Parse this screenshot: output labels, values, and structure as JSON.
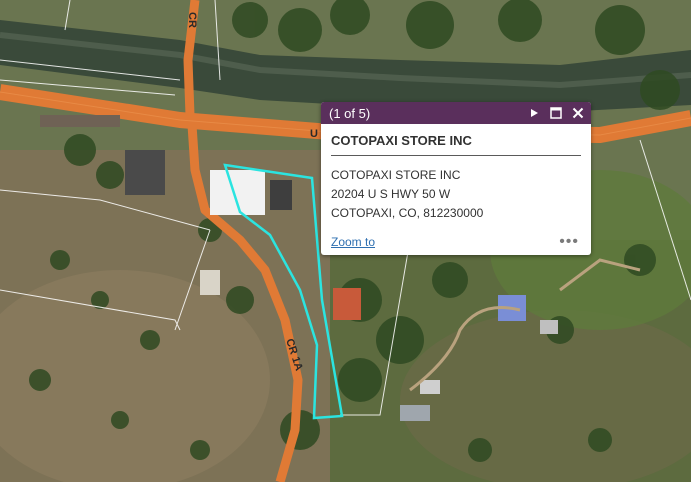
{
  "map": {
    "road_labels": {
      "county_road_1a": "CR 1A",
      "county_road_top": "CR",
      "highway_label": "U"
    }
  },
  "popup": {
    "pager": "(1 of 5)",
    "title": "COTOPAXI STORE INC",
    "lines": [
      "COTOPAXI STORE INC",
      "20204 U S HWY 50 W",
      "COTOPAXI, CO, 812230000"
    ],
    "zoom_label": "Zoom to",
    "more_label": "•••",
    "header_color": "#5a2f5c",
    "icons": {
      "next": "play-icon",
      "maximize": "maximize-icon",
      "close": "close-icon"
    }
  },
  "colors": {
    "highway": "#e07a35",
    "parcel_highlight": "#2be4e0",
    "parcel_lines": "#ffffff"
  }
}
